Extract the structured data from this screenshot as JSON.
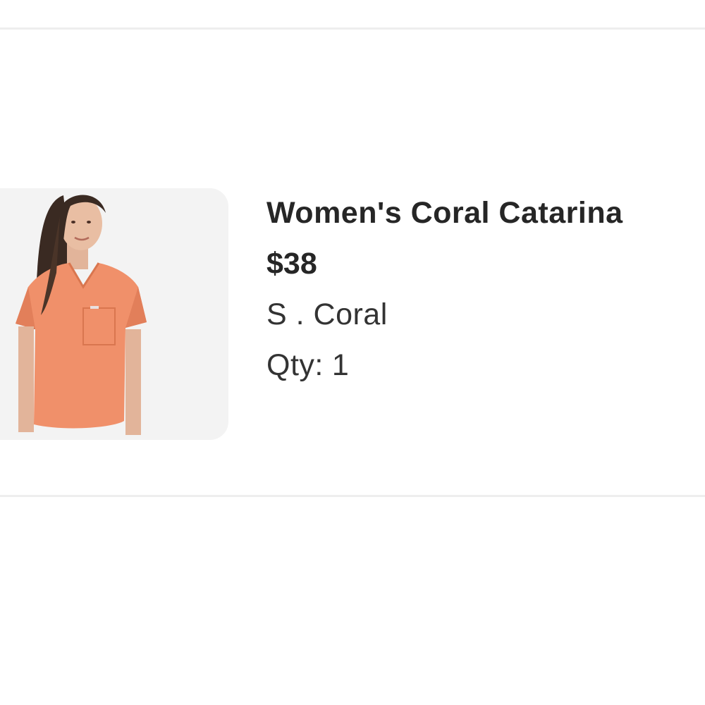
{
  "product": {
    "image_icon": "product-photo",
    "title": "Women's Coral Catarina",
    "price": "$38",
    "variant": "S . Coral",
    "qty_label": "Qty:",
    "qty_value": "1"
  },
  "colors": {
    "divider": "#eeeeee",
    "thumb_bg": "#f3f3f3",
    "text": "#262626",
    "coral": "#f0906a"
  }
}
